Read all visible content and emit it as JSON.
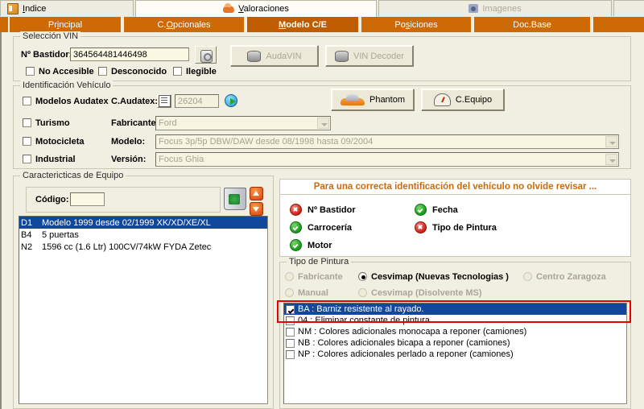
{
  "top_tabs": [
    {
      "label": "Indice",
      "icon": "book-icon",
      "state": "normal",
      "accesskey": "I"
    },
    {
      "label": "Valoraciones",
      "icon": "car-icon",
      "state": "active",
      "accesskey": "V"
    },
    {
      "label": "Imagenes",
      "icon": "camera-icon",
      "state": "disabled",
      "accesskey": ""
    }
  ],
  "sub_tabs": [
    {
      "label": "Principal",
      "active": false,
      "accesskey": "i"
    },
    {
      "label": "C.Opcionales",
      "active": false,
      "accesskey": "O"
    },
    {
      "label": "Modelo C/E",
      "active": true,
      "accesskey": "M"
    },
    {
      "label": "Posiciones",
      "active": false,
      "accesskey": "s"
    },
    {
      "label": "Doc.Base",
      "active": false,
      "accesskey": ""
    }
  ],
  "vin_group": {
    "title": "Selección VIN",
    "bastidor_label": "Nº Bastidor:",
    "bastidor_value": "364564481446498",
    "lookup_icon": "key-lookup-icon",
    "checkboxes": [
      {
        "label": "No Accesible",
        "checked": false
      },
      {
        "label": "Desconocido",
        "checked": false
      },
      {
        "label": "Ilegible",
        "checked": false
      }
    ],
    "buttons": [
      {
        "label": "AudaVIN",
        "icon": "database-icon",
        "disabled": true
      },
      {
        "label": "VIN Decoder",
        "icon": "database-icon",
        "disabled": true
      }
    ]
  },
  "vehicle_group": {
    "title": "Identificación Vehículo",
    "checkboxes": [
      {
        "label": "Modelos Audatex",
        "checked": false
      },
      {
        "label": "Turismo",
        "checked": false
      },
      {
        "label": "Motocicleta",
        "checked": false
      },
      {
        "label": "Industrial",
        "checked": false
      }
    ],
    "fields": [
      {
        "label": "C.Audatex:",
        "value": "26204"
      },
      {
        "label": "Fabricante:",
        "value": "Ford"
      },
      {
        "label": "Modelo:",
        "value": "Focus 3p/5p DBW/DAW desde 08/1998 hasta 09/2004"
      },
      {
        "label": "Versión:",
        "value": "Focus Ghia"
      }
    ],
    "edit_icon": "document-edit-icon",
    "refresh_icon": "globe-refresh-icon",
    "buttons": [
      {
        "label": "Phantom",
        "icon": "car-icon"
      },
      {
        "label": "C.Equipo",
        "icon": "gauge-icon"
      }
    ]
  },
  "equipment_group": {
    "title": "Caractericticas de Equipo",
    "code_label": "Código:",
    "code_value": "",
    "trash_icon": "recycle-bin-icon",
    "up_icon": "arrow-up-icon",
    "down_icon": "arrow-down-icon",
    "rows": [
      {
        "code": "D1",
        "text": "Modelo 1999 desde 02/1999 XK/XD/XE/XL",
        "selected": true
      },
      {
        "code": "B4",
        "text": "5 puertas",
        "selected": false
      },
      {
        "code": "N2",
        "text": "1596 cc (1.6 Ltr) 100CV/74kW FYDA Zetec",
        "selected": false
      }
    ]
  },
  "info_panel": {
    "header": "Para una correcta identificación del vehículo no olvide revisar ...",
    "items": [
      {
        "label": "Nº Bastidor",
        "status": "bad",
        "col": 0,
        "row": 0
      },
      {
        "label": "Fecha",
        "status": "ok",
        "col": 1,
        "row": 0
      },
      {
        "label": "Carrocería",
        "status": "ok",
        "col": 0,
        "row": 1
      },
      {
        "label": "Tipo de Pintura",
        "status": "bad",
        "col": 1,
        "row": 1
      },
      {
        "label": "Motor",
        "status": "ok",
        "col": 0,
        "row": 2
      }
    ]
  },
  "paint_group": {
    "title": "Tipo de Pintura",
    "radios": [
      {
        "label": "Fabricante",
        "selected": false,
        "disabled": true,
        "col": 0,
        "row": 0
      },
      {
        "label": "Cesvimap (Nuevas Tecnologias )",
        "selected": true,
        "disabled": false,
        "col": 1,
        "row": 0
      },
      {
        "label": "Centro Zaragoza",
        "selected": false,
        "disabled": true,
        "col": 2,
        "row": 0
      },
      {
        "label": "Manual",
        "selected": false,
        "disabled": true,
        "col": 0,
        "row": 1
      },
      {
        "label": "Cesvimap (Disolvente MS)",
        "selected": false,
        "disabled": true,
        "col": 1,
        "row": 1
      }
    ],
    "options": [
      {
        "label": "BA : Barniz resistente al rayado.",
        "checked": true,
        "selected": true
      },
      {
        "label": "04 : Eliminar constante de pintura.",
        "checked": false,
        "selected": false
      },
      {
        "label": "NM : Colores adicionales monocapa a reponer (camiones)",
        "checked": false,
        "selected": false
      },
      {
        "label": "NB : Colores adicionales bicapa a reponer (camiones)",
        "checked": false,
        "selected": false
      },
      {
        "label": "NP : Colores adicionales perlado a reponer (camiones)",
        "checked": false,
        "selected": false
      }
    ]
  },
  "colors": {
    "orange_bar": "#cd6a05",
    "orange_active": "#bf5c00",
    "accent_text": "#cd6a05",
    "selection_blue": "#12489c",
    "annotation_red": "#e80000",
    "window_bg": "#f1efe2"
  }
}
